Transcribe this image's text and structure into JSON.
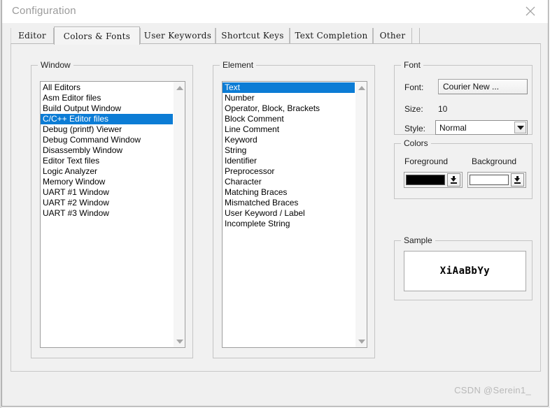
{
  "window": {
    "title": "Configuration",
    "close_icon": "close-icon"
  },
  "tabs": [
    {
      "label": "Editor",
      "active": false
    },
    {
      "label": "Colors & Fonts",
      "active": true
    },
    {
      "label": "User Keywords",
      "active": false
    },
    {
      "label": "Shortcut Keys",
      "active": false
    },
    {
      "label": "Text Completion",
      "active": false
    },
    {
      "label": "Other",
      "active": false
    }
  ],
  "window_group": {
    "label": "Window",
    "items": [
      "All Editors",
      "Asm Editor files",
      "Build Output Window",
      "C/C++ Editor files",
      "Debug (printf) Viewer",
      "Debug Command Window",
      "Disassembly Window",
      "Editor Text files",
      "Logic Analyzer",
      "Memory Window",
      "UART #1 Window",
      "UART #2 Window",
      "UART #3 Window"
    ],
    "selected_index": 3,
    "scroll_up_icon": "triangle-up-icon",
    "scroll_down_icon": "triangle-down-icon"
  },
  "element_group": {
    "label": "Element",
    "items": [
      "Text",
      "Number",
      "Operator, Block, Brackets",
      "Block Comment",
      "Line Comment",
      "Keyword",
      "String",
      "Identifier",
      "Preprocessor",
      "Character",
      "Matching Braces",
      "Mismatched Braces",
      "User Keyword / Label",
      "Incomplete String"
    ],
    "selected_index": 0,
    "scroll_up_icon": "triangle-up-icon",
    "scroll_down_icon": "triangle-down-icon"
  },
  "font_group": {
    "label": "Font",
    "font_label": "Font:",
    "font_value": "Courier New ...",
    "size_label": "Size:",
    "size_value": "10",
    "style_label": "Style:",
    "style_value": "Normal",
    "style_arrow_icon": "chevron-down-icon"
  },
  "colors_group": {
    "label": "Colors",
    "foreground_label": "Foreground",
    "background_label": "Background",
    "foreground_color": "#000000",
    "background_color": "#ffffff",
    "dropdown_icon": "color-dropdown-icon"
  },
  "sample_group": {
    "label": "Sample",
    "text": "XiAaBbYy"
  },
  "watermark": {
    "text": "CSDN @Serein1_"
  },
  "theme": {
    "selection_blue": "#0c7cd5",
    "panel_bg": "#f1f1f1",
    "window_bg": "#f0f0f0"
  }
}
